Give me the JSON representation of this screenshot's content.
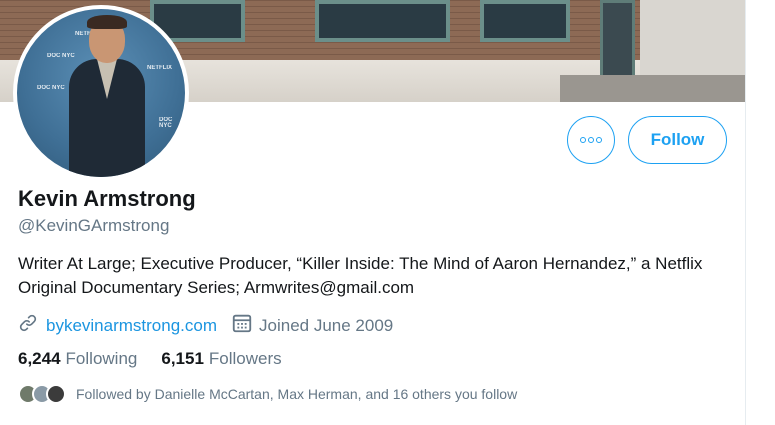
{
  "profile": {
    "name": "Kevin Armstrong",
    "handle": "@KevinGArmstrong",
    "bio": "Writer At Large; Executive Producer, “Killer Inside: The Mind of Aaron Hernandez,” a Netflix Original Documentary Series; Armwrites@gmail.com",
    "website": "bykevinarmstrong.com",
    "joined": "Joined June 2009"
  },
  "counts": {
    "following_num": "6,244",
    "following_label": "Following",
    "followers_num": "6,151",
    "followers_label": "Followers"
  },
  "actions": {
    "follow_label": "Follow",
    "more_icon": "more-horizontal-icon"
  },
  "followed_by": "Followed by Danielle McCartan, Max Herman, and 16 others you follow",
  "avatar_backdrop_text": [
    "NETFLIX",
    "DOC NYC",
    "DOC NYC",
    "NETFLIX",
    "DOC NYC"
  ],
  "icons": {
    "link": "link-icon",
    "calendar": "calendar-icon"
  },
  "colors": {
    "accent": "#1da1f2",
    "link": "#1b95e0",
    "secondary_text": "#657786",
    "primary_text": "#14171a"
  }
}
